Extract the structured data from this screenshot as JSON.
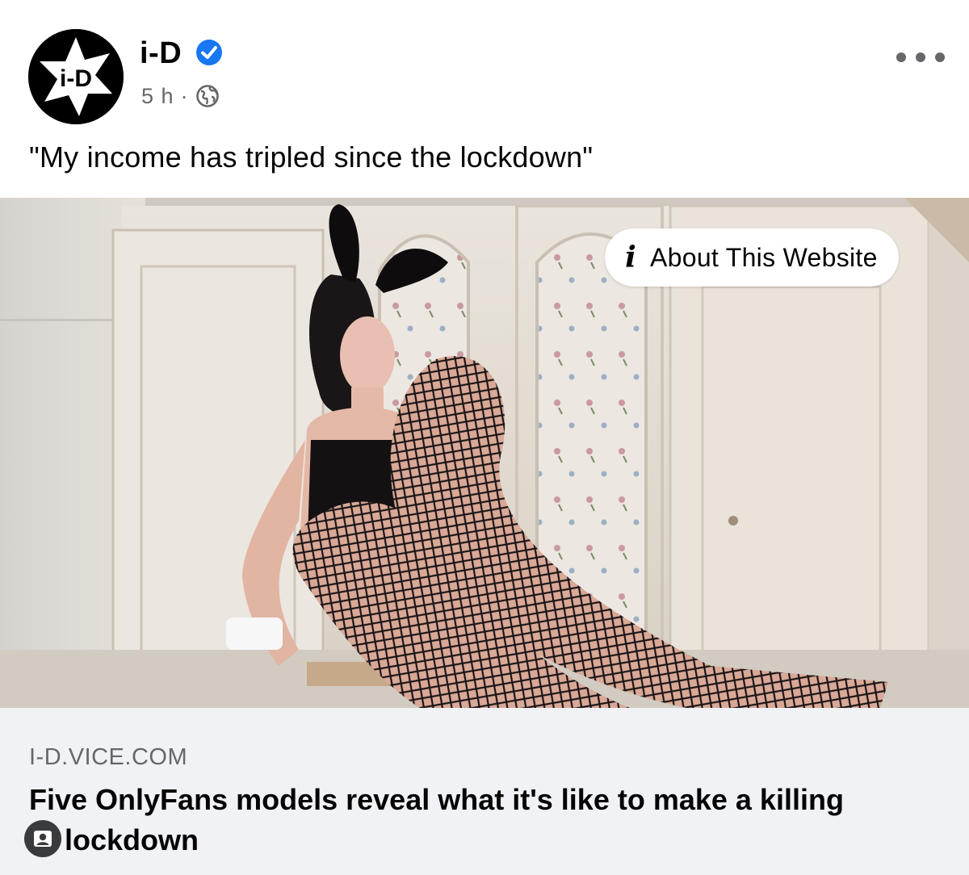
{
  "post": {
    "author": {
      "name": "i-D",
      "avatar_text": "i-D",
      "verified": true
    },
    "meta": {
      "time": "5 h",
      "separator": "·",
      "audience_icon": "globe-icon"
    },
    "menu_icon": "more-horizontal-icon",
    "text": "\"My income has tripled since the lockdown\"",
    "image": {
      "overlay_button": {
        "icon": "info-icon",
        "icon_glyph": "i",
        "label": "About This Website"
      }
    },
    "link_preview": {
      "domain": "I-D.VICE.COM",
      "title": "Five OnlyFans models reveal what it's like to make a killing in lockdown",
      "title_visible_line1": "Five OnlyFans models reveal what it's like to make a killing",
      "title_visible_line2": "lockdown"
    },
    "badge_icon": "user-icon"
  },
  "colors": {
    "brand_blue": "#1877f2",
    "secondary_text": "#65676b",
    "link_background": "#f0f2f5"
  }
}
